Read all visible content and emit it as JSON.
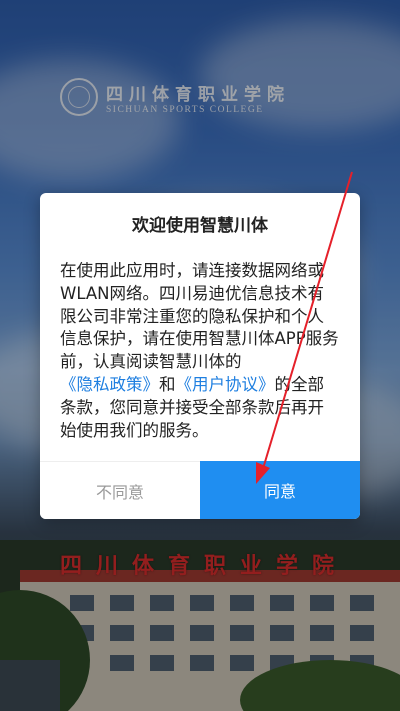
{
  "background": {
    "school_name_cn": "四川体育职业学院",
    "school_name_en": "SICHUAN SPORTS COLLEGE",
    "building_sign": "四川体育职业学院"
  },
  "dialog": {
    "title": "欢迎使用智慧川体",
    "body_part1": "在使用此应用时，请连接数据网络或WLAN网络。四川易迪优信息技术有限公司非常注重您的隐私保护和个人信息保护，请在使用智慧川体APP服务前，认真阅读智慧川体的",
    "privacy_link": "《隐私政策》",
    "body_and": "和",
    "user_agreement_link": "《用户协议》",
    "body_part2": "的全部条款，您同意并接受全部条款后再开始使用我们的服务。",
    "disagree_label": "不同意",
    "agree_label": "同意"
  },
  "colors": {
    "accent": "#1f8ef1",
    "link": "#1f7fe0",
    "annotation": "#e5202a"
  }
}
